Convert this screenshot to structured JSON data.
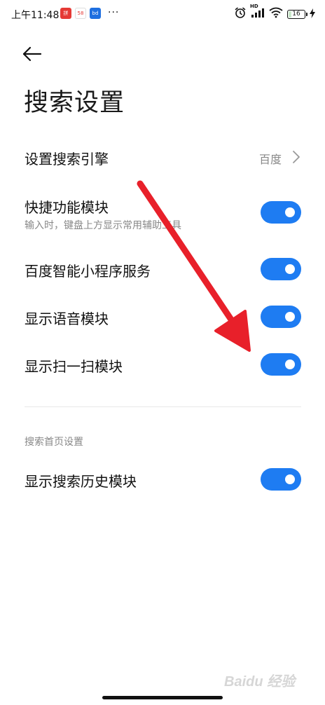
{
  "status_bar": {
    "time": "上午11:48",
    "apps": [
      "app-icon-1",
      "app-icon-2",
      "app-icon-3"
    ],
    "app_labels": [
      "拼",
      "58",
      "bd"
    ],
    "more": "···",
    "hd_label": "HD",
    "battery_level": "16",
    "icons": [
      "alarm-icon",
      "signal-icon",
      "wifi-icon",
      "battery-icon",
      "charging-icon"
    ]
  },
  "header": {
    "back_icon": "back-arrow-icon",
    "title": "搜索设置"
  },
  "settings": {
    "engine": {
      "label": "设置搜索引擎",
      "value": "百度"
    },
    "shortcut": {
      "label": "快捷功能模块",
      "subtitle": "输入时，键盘上方显示常用辅助工具",
      "enabled": true
    },
    "mini_program": {
      "label": "百度智能小程序服务",
      "enabled": true
    },
    "voice": {
      "label": "显示语音模块",
      "enabled": true
    },
    "scan": {
      "label": "显示扫一扫模块",
      "enabled": true
    }
  },
  "homepage_section": {
    "header": "搜索首页设置",
    "history": {
      "label": "显示搜索历史模块",
      "enabled": true
    }
  },
  "colors": {
    "accent": "#1e7cf2",
    "annotation": "#e8202a"
  },
  "watermark": "Baidu 经验"
}
